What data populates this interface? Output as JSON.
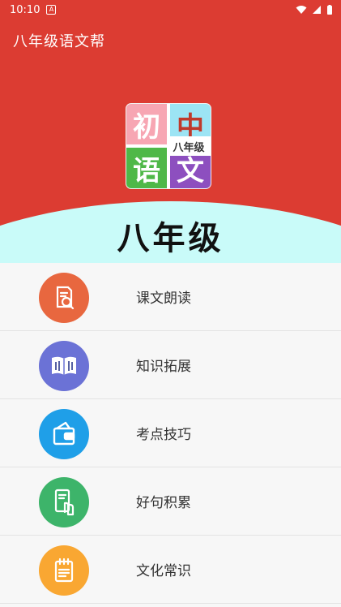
{
  "status_bar": {
    "time": "10:10",
    "notification_glyph": "A"
  },
  "app_bar": {
    "title": "八年级语文帮"
  },
  "hero": {
    "logo": {
      "q1": "初",
      "q2": "中",
      "q3": "语",
      "q4": "文",
      "subtitle": "八年级"
    },
    "grade_text": "八年级"
  },
  "menu": [
    {
      "label": "课文朗读",
      "icon": "document-search-icon",
      "color": "#e8673f"
    },
    {
      "label": "知识拓展",
      "icon": "open-book-icon",
      "color": "#6b72d6"
    },
    {
      "label": "考点技巧",
      "icon": "wallet-icon",
      "color": "#1f9fe8"
    },
    {
      "label": "好句积累",
      "icon": "phone-tap-icon",
      "color": "#3db46a"
    },
    {
      "label": "文化常识",
      "icon": "notepad-icon",
      "color": "#f9a732"
    }
  ],
  "colors": {
    "primary": "#dc3c32",
    "arc": "#c9fbf9"
  }
}
